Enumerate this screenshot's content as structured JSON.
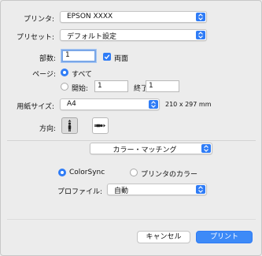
{
  "printer": {
    "label": "プリンタ:",
    "value": "EPSON XXXX"
  },
  "preset": {
    "label": "プリセット:",
    "value": "デフォルト設定"
  },
  "copies": {
    "label": "部数:",
    "value": "1",
    "duplex_label": "両面",
    "duplex_checked": true
  },
  "pages": {
    "label": "ページ:",
    "all_label": "すべて",
    "from_label": "開始:",
    "from_value": "1",
    "to_label": "終了:",
    "to_value": "1",
    "selected": "all"
  },
  "paper_size": {
    "label": "用紙サイズ:",
    "value": "A4",
    "dimensions": "210 x 297 mm"
  },
  "orientation": {
    "label": "方向:",
    "selected": "portrait"
  },
  "section_menu": {
    "value": "カラー・マッチング"
  },
  "color_matching": {
    "colorsync_label": "ColorSync",
    "printer_color_label": "プリンタのカラー",
    "selected": "colorsync",
    "profile_label": "プロファイル:",
    "profile_value": "自動"
  },
  "buttons": {
    "cancel": "キャンセル",
    "print": "プリント"
  },
  "colors": {
    "accent": "#2f7cf6",
    "background": "#ececec"
  }
}
